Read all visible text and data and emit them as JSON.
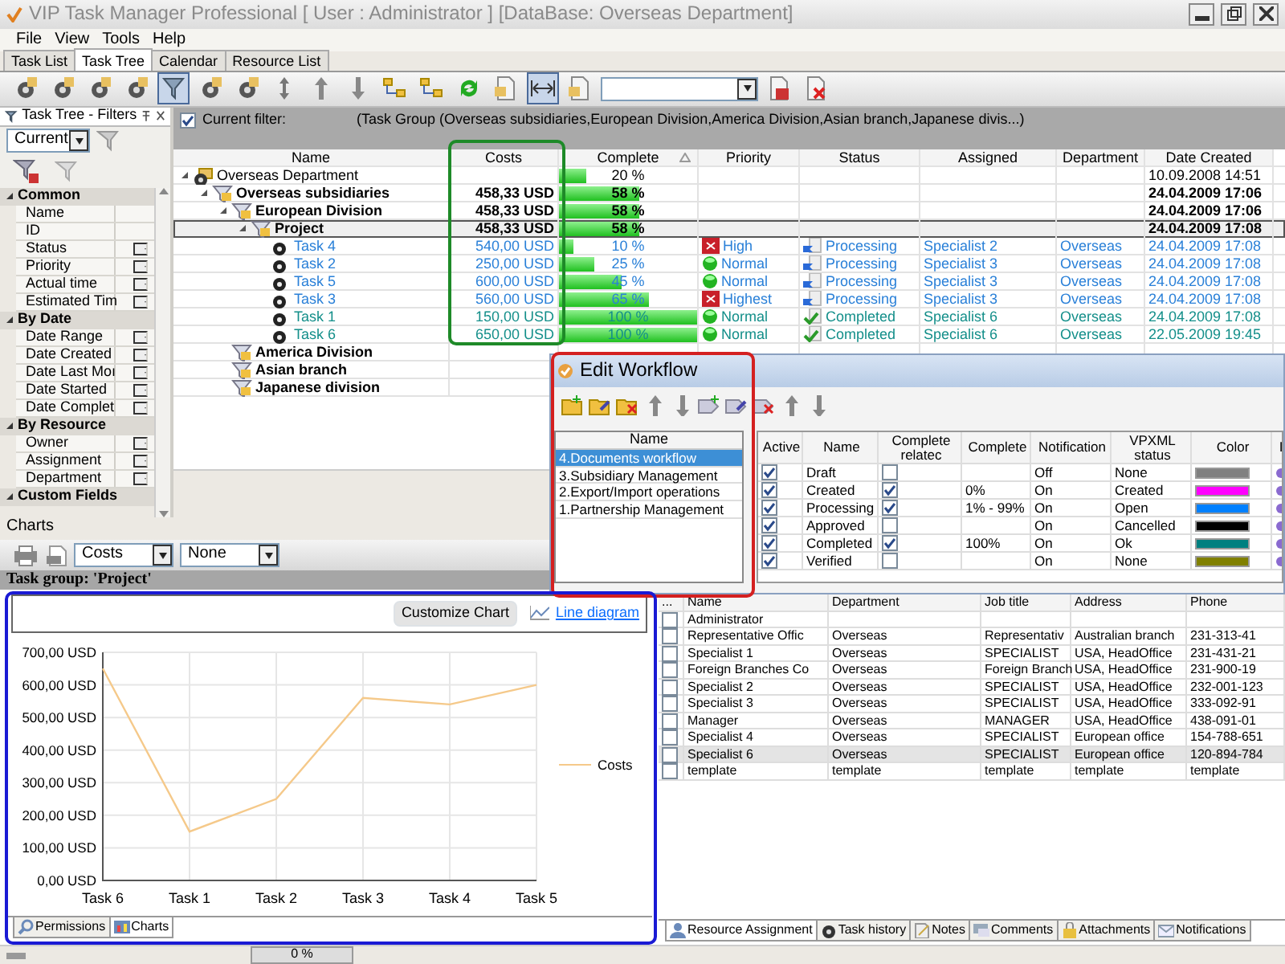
{
  "window": {
    "title": "VIP Task Manager Professional [ User : Administrator ] [DataBase: Overseas Department]"
  },
  "menu": [
    "File",
    "View",
    "Tools",
    "Help"
  ],
  "tabs": [
    {
      "label": "Task List",
      "selected": false
    },
    {
      "label": "Task Tree",
      "selected": true
    },
    {
      "label": "Calendar",
      "selected": false
    },
    {
      "label": "Resource List",
      "selected": false
    }
  ],
  "toolbar": [
    {
      "kind": "task",
      "pressed": false
    },
    {
      "kind": "task",
      "pressed": false
    },
    {
      "kind": "task",
      "pressed": false
    },
    {
      "kind": "task",
      "pressed": false
    },
    {
      "kind": "filter",
      "pressed": true
    },
    {
      "kind": "task",
      "pressed": false
    },
    {
      "kind": "task",
      "pressed": false
    },
    {
      "kind": "updown",
      "pressed": false
    },
    {
      "kind": "up",
      "pressed": false
    },
    {
      "kind": "down",
      "pressed": false
    },
    {
      "kind": "tree",
      "pressed": false
    },
    {
      "kind": "tree",
      "pressed": false
    },
    {
      "kind": "refresh",
      "pressed": false
    },
    {
      "kind": "doc",
      "pressed": false
    },
    {
      "kind": "fit",
      "pressed": true
    },
    {
      "kind": "doc",
      "pressed": false
    },
    {
      "kind": "combo"
    },
    {
      "kind": "save",
      "pressed": false
    },
    {
      "kind": "delete",
      "pressed": false
    }
  ],
  "filters_panel": {
    "title": "Task Tree - Filters",
    "preset": "Current",
    "groups": [
      {
        "label": "Common",
        "expanded": true,
        "fields": [
          {
            "label": "Name",
            "dropdown": false
          },
          {
            "label": "ID",
            "dropdown": false
          },
          {
            "label": "Status",
            "dropdown": true
          },
          {
            "label": "Priority",
            "dropdown": true
          },
          {
            "label": "Actual time",
            "dropdown": true
          },
          {
            "label": "Estimated Tim",
            "dropdown": true
          }
        ]
      },
      {
        "label": "By Date",
        "expanded": true,
        "fields": [
          {
            "label": "Date Range",
            "dropdown": true
          },
          {
            "label": "Date Created",
            "dropdown": true
          },
          {
            "label": "Date Last Moı",
            "dropdown": true
          },
          {
            "label": "Date Started",
            "dropdown": true
          },
          {
            "label": "Date Complet",
            "dropdown": true
          }
        ]
      },
      {
        "label": "By Resource",
        "expanded": true,
        "fields": [
          {
            "label": "Owner",
            "dropdown": true
          },
          {
            "label": "Assignment",
            "dropdown": true
          },
          {
            "label": "Department",
            "dropdown": true
          }
        ]
      },
      {
        "label": "Custom Fields",
        "expanded": true
      }
    ]
  },
  "filter_bar": {
    "checked": true,
    "label": "Current filter:",
    "text": "(Task Group  (Overseas subsidiaries,European Division,America Division,Asian branch,Japanese divis...)"
  },
  "task_tree": {
    "columns": [
      "Name",
      "Costs",
      "Complete",
      "Priority",
      "Status",
      "Assigned",
      "Department",
      "Date Created"
    ],
    "rows": [
      {
        "kind": "department",
        "name": "Overseas Department",
        "complete": "20 %",
        "level": 0.2,
        "date_created": "10.09.2008 14:51",
        "selected": false,
        "expanded": true,
        "children": [
          {
            "kind": "group",
            "name": "Overseas subsidiaries",
            "costs": "458,33 USD",
            "complete": "58 %",
            "level": 0.58,
            "date_created": "24.04.2009 17:06",
            "selected": false,
            "expanded": true,
            "children": [
              {
                "kind": "group",
                "name": "European Division",
                "costs": "458,33 USD",
                "complete": "58 %",
                "level": 0.58,
                "date_created": "24.04.2009 17:06",
                "selected": false,
                "expanded": true,
                "children": [
                  {
                    "kind": "group",
                    "name": "Project",
                    "costs": "458,33 USD",
                    "complete": "58 %",
                    "level": 0.58,
                    "date_created": "24.04.2009 17:08",
                    "selected": true,
                    "expanded": true,
                    "children": [
                      {
                        "kind": "task",
                        "name": "Task 4",
                        "costs": "540,00 USD",
                        "complete": "10 %",
                        "level": 0.1,
                        "priority": {
                          "label": "High",
                          "kind": "alert"
                        },
                        "status": {
                          "label": "Processing",
                          "kind": "processing"
                        },
                        "assigned": "Specialist 2",
                        "department": "Overseas",
                        "date_created": "24.04.2009 17:08",
                        "selected": false
                      },
                      {
                        "kind": "task",
                        "name": "Task 2",
                        "costs": "250,00 USD",
                        "complete": "25 %",
                        "level": 0.25,
                        "priority": {
                          "label": "Normal",
                          "kind": "normal"
                        },
                        "status": {
                          "label": "Processing",
                          "kind": "processing"
                        },
                        "assigned": "Specialist 3",
                        "department": "Overseas",
                        "date_created": "24.04.2009 17:08",
                        "selected": false
                      },
                      {
                        "kind": "task",
                        "name": "Task 5",
                        "costs": "600,00 USD",
                        "complete": "45 %",
                        "level": 0.45,
                        "priority": {
                          "label": "Normal",
                          "kind": "normal"
                        },
                        "status": {
                          "label": "Processing",
                          "kind": "processing"
                        },
                        "assigned": "Specialist 3",
                        "department": "Overseas",
                        "date_created": "24.04.2009 17:08",
                        "selected": false
                      },
                      {
                        "kind": "task",
                        "name": "Task 3",
                        "costs": "560,00 USD",
                        "complete": "65 %",
                        "level": 0.65,
                        "priority": {
                          "label": "Highest",
                          "kind": "alert"
                        },
                        "status": {
                          "label": "Processing",
                          "kind": "processing"
                        },
                        "assigned": "Specialist 3",
                        "department": "Overseas",
                        "date_created": "24.04.2009 17:08",
                        "selected": false
                      },
                      {
                        "kind": "task",
                        "name": "Task 1",
                        "costs": "150,00 USD",
                        "complete": "100 %",
                        "level": 1,
                        "priority": {
                          "label": "Normal",
                          "kind": "normal"
                        },
                        "status": {
                          "label": "Completed",
                          "kind": "completed"
                        },
                        "assigned": "Specialist 6",
                        "department": "Overseas",
                        "date_created": "24.04.2009 17:08",
                        "selected": false
                      },
                      {
                        "kind": "task",
                        "name": "Task 6",
                        "costs": "650,00 USD",
                        "complete": "100 %",
                        "level": 1,
                        "priority": {
                          "label": "Normal",
                          "kind": "normal"
                        },
                        "status": {
                          "label": "Completed",
                          "kind": "completed"
                        },
                        "assigned": "Specialist 6",
                        "department": "Overseas",
                        "date_created": "22.05.2009 19:45",
                        "selected": false
                      }
                    ]
                  }
                ]
              },
              {
                "kind": "group",
                "name": "America Division",
                "selected": false
              },
              {
                "kind": "group",
                "name": "Asian branch",
                "selected": false
              },
              {
                "kind": "group",
                "name": "Japanese division",
                "selected": false
              }
            ]
          }
        ]
      }
    ]
  },
  "edit_workflow": {
    "title": "Edit Workflow",
    "list_column": "Name",
    "workflows": [
      {
        "label": "4.Documents workflow",
        "selected": true
      },
      {
        "label": "3.Subsidiary Management",
        "selected": false
      },
      {
        "label": "2.Export/Import operations",
        "selected": false
      },
      {
        "label": "1.Partnership Management",
        "selected": false
      }
    ],
    "columns": [
      "Active",
      "Name",
      "Complete relatec",
      "Complete",
      "Notification",
      "VPXML status",
      "Color",
      "I"
    ],
    "states": [
      {
        "active": true,
        "name": "Draft",
        "complete_related": false,
        "notification": "Off",
        "vpxml_status": "None",
        "color": "#808080"
      },
      {
        "active": true,
        "name": "Created",
        "complete_related": true,
        "complete": "0%",
        "notification": "On",
        "vpxml_status": "Created",
        "color": "#ff00ff"
      },
      {
        "active": true,
        "name": "Processing",
        "complete_related": true,
        "complete": "1% - 99%",
        "notification": "On",
        "vpxml_status": "Open",
        "color": "#0080ff"
      },
      {
        "active": true,
        "name": "Approved",
        "complete_related": false,
        "notification": "On",
        "vpxml_status": "Cancelled",
        "color": "#000000"
      },
      {
        "active": true,
        "name": "Completed",
        "complete_related": true,
        "complete": "100%",
        "notification": "On",
        "vpxml_status": "Ok",
        "color": "#008080"
      },
      {
        "active": true,
        "name": "Verified",
        "complete_related": false,
        "notification": "On",
        "vpxml_status": "None",
        "color": "#808000"
      }
    ]
  },
  "charts_panel": {
    "title": "Charts",
    "value_select": "Costs",
    "group_select": "None",
    "group_caption": "Task group: 'Project'",
    "customize_button": "Customize Chart",
    "chart_type_link": "Line diagram",
    "chart_data": {
      "type": "line",
      "grid": true,
      "categories": [
        "Task 6",
        "Task 1",
        "Task 2",
        "Task 3",
        "Task 4",
        "Task 5"
      ],
      "series": [
        {
          "name": "Costs",
          "color": "#f5c98a",
          "values": [
            650,
            150,
            250,
            560,
            540,
            600
          ]
        }
      ],
      "ylim": [
        0,
        700
      ],
      "yticks": [
        {
          "value": 0,
          "label": "0,00 USD"
        },
        {
          "value": 100,
          "label": "100,00 USD"
        },
        {
          "value": 200,
          "label": "200,00 USD"
        },
        {
          "value": 300,
          "label": "300,00 USD"
        },
        {
          "value": 400,
          "label": "400,00 USD"
        },
        {
          "value": 500,
          "label": "500,00 USD"
        },
        {
          "value": 600,
          "label": "600,00 USD"
        },
        {
          "value": 700,
          "label": "700,00 USD"
        }
      ]
    },
    "tabs": [
      {
        "label": "Permissions",
        "selected": false
      },
      {
        "label": "Charts",
        "selected": true
      }
    ]
  },
  "resources": {
    "checkbox_column": "...",
    "columns": [
      "Name",
      "Department",
      "Job title",
      "Address",
      "Phone"
    ],
    "rows": [
      {
        "checked": false,
        "selected": false,
        "cells": [
          "Administrator",
          "",
          "",
          "",
          ""
        ]
      },
      {
        "checked": false,
        "selected": false,
        "cells": [
          "Representative Offic",
          "Overseas",
          "Representativ",
          "Australian branch",
          "231-313-41"
        ]
      },
      {
        "checked": false,
        "selected": false,
        "cells": [
          "Specialist 1",
          "Overseas",
          "SPECIALIST",
          "USA, HeadOffice",
          "231-431-21"
        ]
      },
      {
        "checked": false,
        "selected": false,
        "cells": [
          "Foreign Branches Co",
          "Overseas",
          "Foreign Branch",
          "USA, HeadOffice",
          "231-900-19"
        ]
      },
      {
        "checked": false,
        "selected": false,
        "cells": [
          "Specialist 2",
          "Overseas",
          "SPECIALIST",
          "USA, HeadOffice",
          "232-001-123"
        ]
      },
      {
        "checked": false,
        "selected": false,
        "cells": [
          "Specialist 3",
          "Overseas",
          "SPECIALIST",
          "USA, HeadOffice",
          "333-092-91"
        ]
      },
      {
        "checked": false,
        "selected": false,
        "cells": [
          "Manager",
          "Overseas",
          "MANAGER",
          "USA, HeadOffice",
          "438-091-01"
        ]
      },
      {
        "checked": false,
        "selected": false,
        "cells": [
          "Specialist 4",
          "Overseas",
          "SPECIALIST",
          "European office",
          "154-788-651"
        ]
      },
      {
        "checked": false,
        "selected": true,
        "cells": [
          "Specialist 6",
          "Overseas",
          "SPECIALIST",
          "European office",
          "120-894-784"
        ]
      },
      {
        "checked": false,
        "selected": false,
        "cells": [
          "template",
          "template",
          "template",
          "template",
          "template"
        ]
      }
    ],
    "tabs": [
      {
        "label": "Resource Assignment",
        "selected": true
      },
      {
        "label": "Task history",
        "selected": false
      },
      {
        "label": "Notes",
        "selected": false
      },
      {
        "label": "Comments",
        "selected": false
      },
      {
        "label": "Attachments",
        "selected": false
      },
      {
        "label": "Notifications",
        "selected": false
      }
    ]
  },
  "status_bar": {
    "progress": "0 %"
  }
}
